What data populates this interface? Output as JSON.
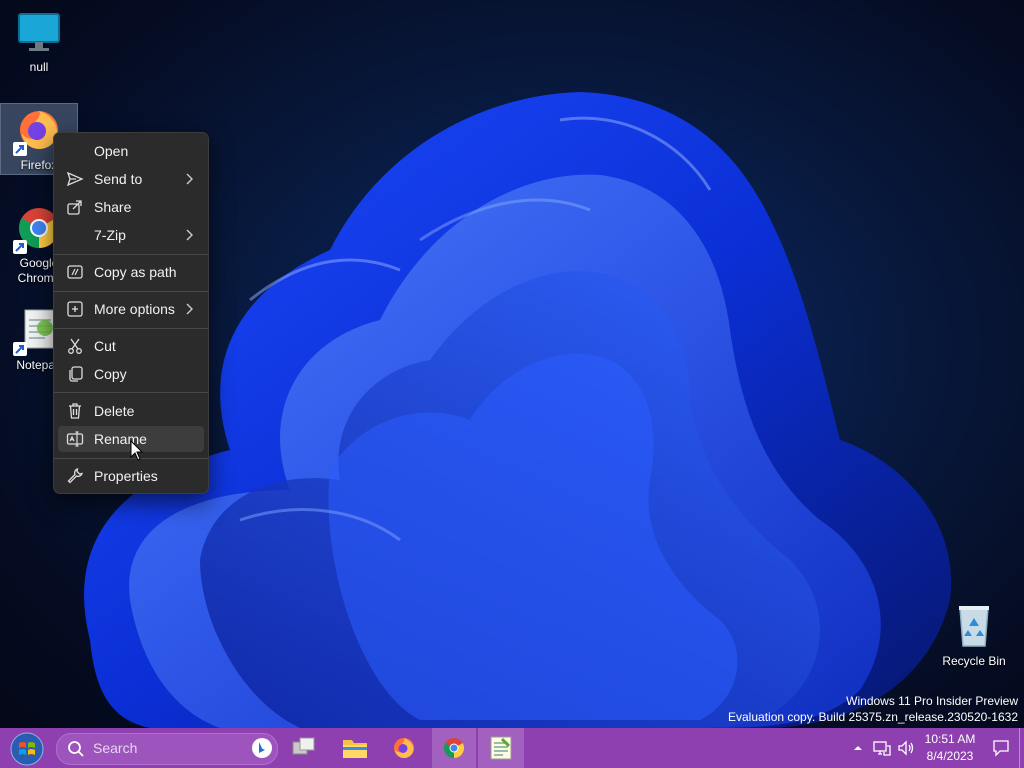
{
  "desktop": {
    "icons": [
      {
        "label": "null",
        "icon": "monitor-icon"
      },
      {
        "label": "Firefox",
        "icon": "firefox-icon"
      },
      {
        "label": "Google Chrome",
        "icon": "chrome-icon"
      },
      {
        "label": "Notepad",
        "icon": "notepad-icon"
      },
      {
        "label": "Recycle Bin",
        "icon": "recycle-bin-icon"
      }
    ]
  },
  "context_menu": {
    "items": [
      {
        "label": "Open",
        "icon": "",
        "submenu": false
      },
      {
        "label": "Send to",
        "icon": "send-icon",
        "submenu": true
      },
      {
        "label": "Share",
        "icon": "share-icon",
        "submenu": false
      },
      {
        "label": "7-Zip",
        "icon": "",
        "submenu": true
      },
      {
        "label": "Copy as path",
        "icon": "copy-path-icon",
        "submenu": false
      },
      {
        "label": "More options",
        "icon": "more-options-icon",
        "submenu": true
      },
      {
        "label": "Cut",
        "icon": "scissors-icon",
        "submenu": false
      },
      {
        "label": "Copy",
        "icon": "copy-icon",
        "submenu": false
      },
      {
        "label": "Delete",
        "icon": "trash-icon",
        "submenu": false
      },
      {
        "label": "Rename",
        "icon": "rename-icon",
        "submenu": false,
        "hovered": true
      },
      {
        "label": "Properties",
        "icon": "wrench-icon",
        "submenu": false
      }
    ]
  },
  "watermark": {
    "line1": "Windows 11 Pro Insider Preview",
    "line2": "Evaluation copy. Build 25375.zn_release.230520-1632"
  },
  "taskbar": {
    "search_placeholder": "Search",
    "apps": [
      "file-explorer-icon",
      "firefox-icon",
      "chrome-icon",
      "notepad-icon"
    ],
    "clock": {
      "time": "10:51 AM",
      "date": "8/4/2023"
    },
    "accent": "#8e3fb0"
  }
}
